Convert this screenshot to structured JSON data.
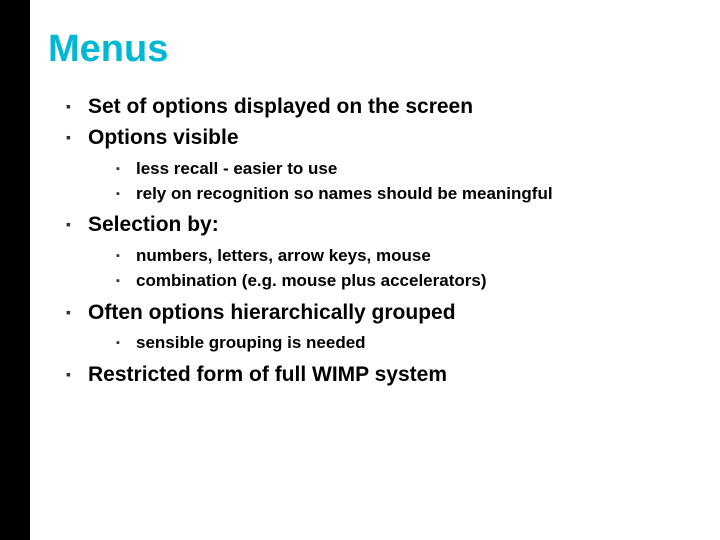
{
  "title": "Menus",
  "bullets": [
    {
      "text": "Set of options displayed on the screen",
      "children": []
    },
    {
      "text": "Options visible",
      "children": [
        "less recall - easier to use",
        "rely on recognition so names should be meaningful"
      ]
    },
    {
      "text": "Selection by:",
      "children": [
        "numbers, letters, arrow keys, mouse",
        "combination  (e.g. mouse plus accelerators)"
      ]
    },
    {
      "text": "Often options hierarchically grouped",
      "children": [
        "sensible grouping is needed"
      ]
    },
    {
      "text": "Restricted form of full WIMP system",
      "children": []
    }
  ]
}
